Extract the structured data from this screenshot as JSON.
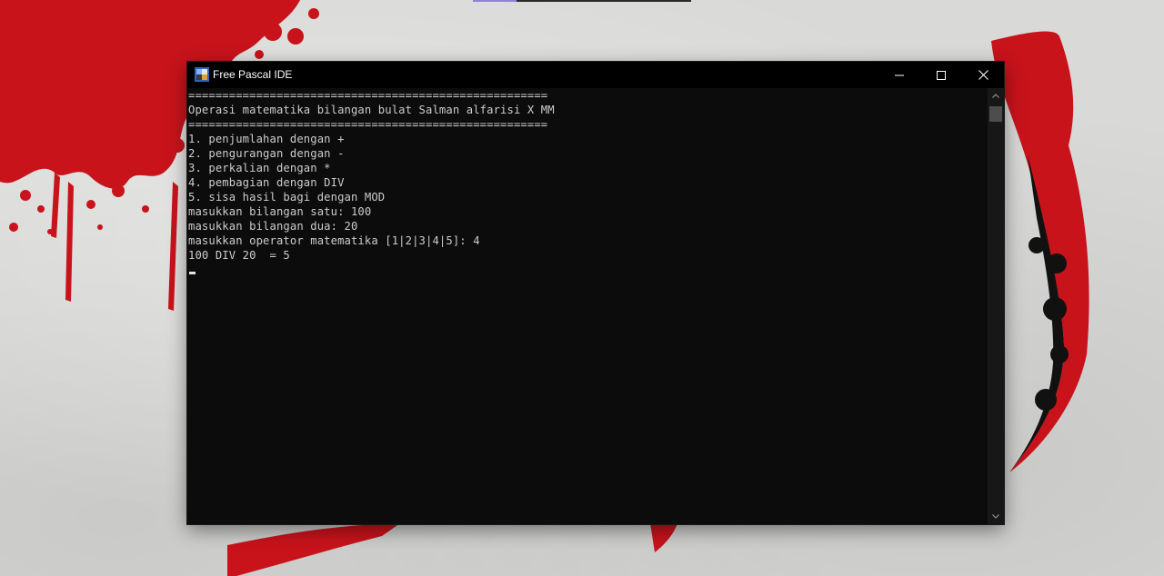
{
  "window": {
    "title": "Free Pascal IDE",
    "icon": "free-pascal-app-icon"
  },
  "console": {
    "lines": [
      "=====================================================",
      "Operasi matematika bilangan bulat Salman alfarisi X MM",
      "=====================================================",
      "1. penjumlahan dengan +",
      "2. pengurangan dengan -",
      "3. perkalian dengan *",
      "4. pembagian dengan DIV",
      "5. sisa hasil bagi dengan MOD",
      "masukkan bilangan satu: 100",
      "masukkan bilangan dua: 20",
      "masukkan operator matematika [1|2|3|4|5]: 4",
      "100 DIV 20  = 5"
    ]
  },
  "colors": {
    "console_bg": "#0c0c0c",
    "console_text": "#cccccc",
    "titlebar_bg": "#000000",
    "wallpaper_red": "#c8131b"
  },
  "icons": {
    "minimize": "minimize-icon",
    "maximize": "maximize-icon",
    "close": "close-icon",
    "scroll_up": "chevron-up-icon",
    "scroll_down": "chevron-down-icon"
  }
}
